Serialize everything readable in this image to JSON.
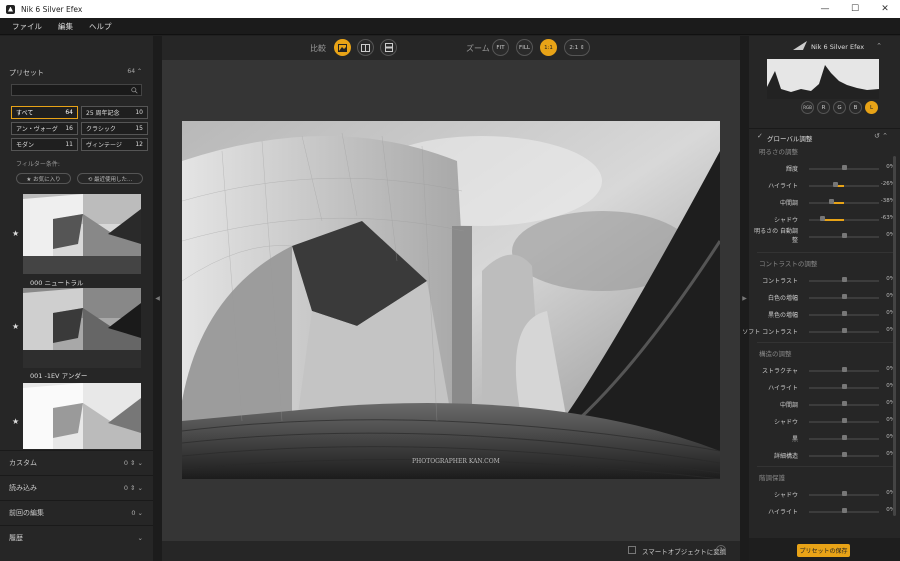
{
  "window": {
    "title": "Nik 6 Silver Efex",
    "minimize": "—",
    "maximize": "☐",
    "close": "✕"
  },
  "menu": [
    "ファイル",
    "編集",
    "ヘルプ"
  ],
  "left": {
    "presets_label": "プリセット",
    "presets_count": "64 ⌃",
    "tags": [
      {
        "label": "すべて",
        "count": "64"
      },
      {
        "label": "25 周年記念",
        "count": "10"
      },
      {
        "label": "アン・ヴォーグ",
        "count": "16"
      },
      {
        "label": "クラシック",
        "count": "15"
      },
      {
        "label": "モダン",
        "count": "11"
      },
      {
        "label": "ヴィンテージ",
        "count": "12"
      }
    ],
    "filter_label": "フィルター条件:",
    "filter_favorites": "★ お気に入り",
    "filter_recent": "⟲ 最近使用した...",
    "thumbs": [
      {
        "label": "000 ニュートラル"
      },
      {
        "label": "001 -1EV アンダー"
      },
      {
        "label": ""
      }
    ],
    "sections": [
      {
        "label": "カスタム",
        "ctl": "0 ⇕ ⌄"
      },
      {
        "label": "読み込み",
        "ctl": "0 ⇕ ⌄"
      },
      {
        "label": "前回の編集",
        "ctl": "0 ⌄"
      },
      {
        "label": "履歴",
        "ctl": "⌄"
      }
    ]
  },
  "toolbar": {
    "compare_label": "比較",
    "zoom_label": "ズーム",
    "fit": "FIT",
    "fill": "FILL",
    "one": "1:1",
    "two": "2:1 ⇕"
  },
  "bottom": {
    "smart_label": "スマートオブジェクトに変換",
    "help": "?"
  },
  "right": {
    "brand": "Nik 6 Silver Efex",
    "collapse": "⌃",
    "channels": [
      "RGB",
      "R",
      "G",
      "B",
      "L"
    ],
    "global_label": "グローバル調整",
    "groups": [
      {
        "title": "明るさの調整",
        "rows": [
          {
            "label": "輝度",
            "value": "0%",
            "pct": 0
          },
          {
            "label": "ハイライト",
            "value": "-26%",
            "pct": -26
          },
          {
            "label": "中間調",
            "value": "-38%",
            "pct": -38
          },
          {
            "label": "シャドウ",
            "value": "-63%",
            "pct": -63
          },
          {
            "label": "明るさの 自動調整",
            "value": "0%",
            "pct": 0
          }
        ]
      },
      {
        "title": "コントラストの調整",
        "rows": [
          {
            "label": "コントラスト",
            "value": "0%",
            "pct": 0
          },
          {
            "label": "白色の増幅",
            "value": "0%",
            "pct": 0
          },
          {
            "label": "黒色の増幅",
            "value": "0%",
            "pct": 0
          },
          {
            "label": "ソフト コントラスト",
            "value": "0%",
            "pct": 0
          }
        ]
      },
      {
        "title": "構造の調整",
        "rows": [
          {
            "label": "ストラクチャ",
            "value": "0%",
            "pct": 0
          },
          {
            "label": "ハイライト",
            "value": "0%",
            "pct": 0
          },
          {
            "label": "中間調",
            "value": "0%",
            "pct": 0
          },
          {
            "label": "シャドウ",
            "value": "0%",
            "pct": 0
          },
          {
            "label": "黒",
            "value": "0%",
            "pct": 0
          },
          {
            "label": "詳細構造",
            "value": "0%",
            "pct": 0
          }
        ]
      },
      {
        "title": "階調保護",
        "rows": [
          {
            "label": "シャドウ",
            "value": "0%",
            "pct": 0
          },
          {
            "label": "ハイライト",
            "value": "0%",
            "pct": 0
          }
        ]
      }
    ],
    "save_preset": "プリセットの保存"
  },
  "photo_watermark": "PHOTOGRAPHER KAN.COM"
}
